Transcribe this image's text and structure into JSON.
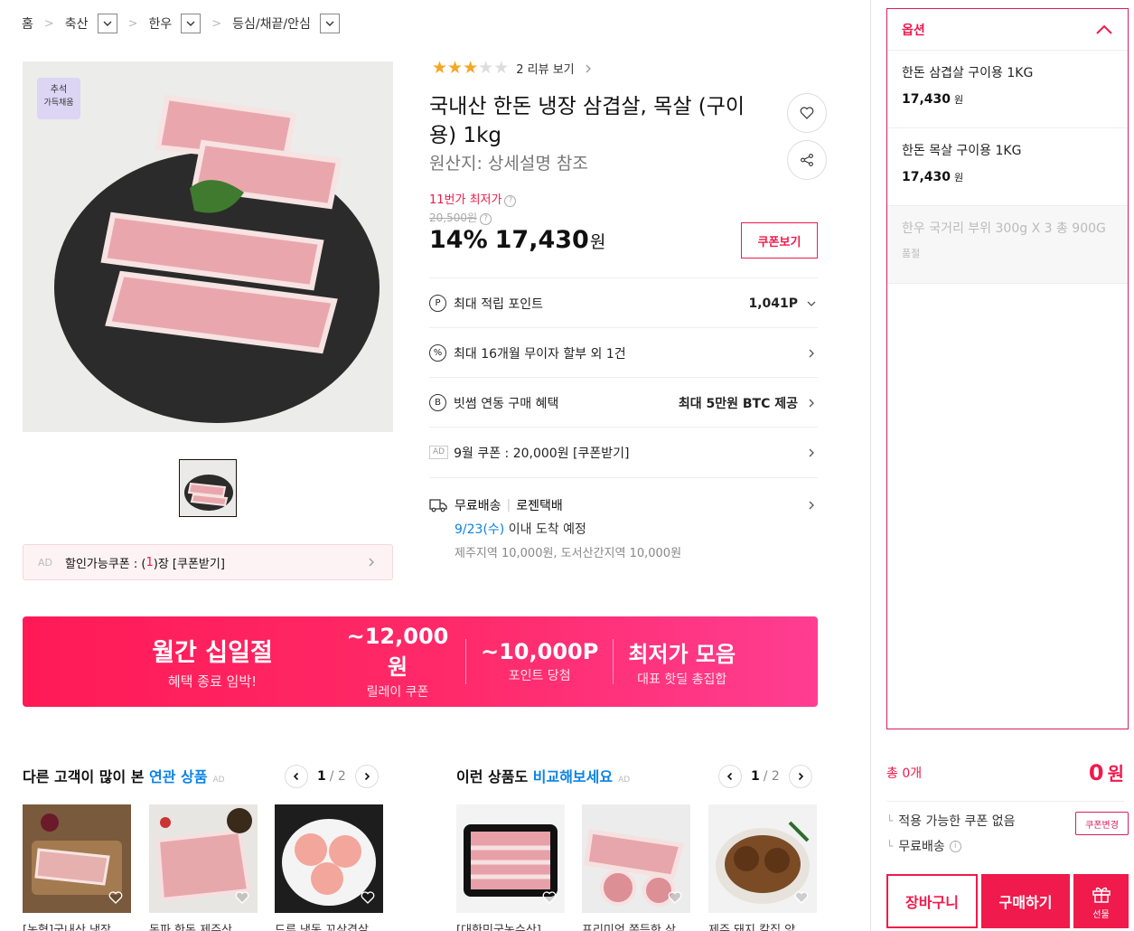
{
  "breadcrumb": {
    "home": "홈",
    "cat1": "축산",
    "cat2": "한우",
    "cat3": "등심/채끝/안심"
  },
  "product": {
    "badge": "추석\n가득채움",
    "rating": 3,
    "review_link": "2 리뷰 보기",
    "title": "국내산 한돈 냉장 삼겹살, 목살 (구이용) 1kg",
    "origin": "원산지:  상세설명 참조",
    "lowest_label": "11번가 최저가",
    "original_price": "20,500원",
    "discount": "14%",
    "price": "17,430",
    "price_unit": "원",
    "coupon_button": "쿠폰보기"
  },
  "benefits": [
    {
      "icon": "P",
      "label": "최대 적립 포인트",
      "value": "1,041P"
    },
    {
      "icon": "%",
      "label": "최대 16개월 무이자 할부 외 1건",
      "value": ""
    },
    {
      "icon": "B",
      "label": "빗썸 연동 구매 혜택",
      "value": "최대 5만원 BTC 제공"
    },
    {
      "icon": "AD",
      "label": "9월 쿠폰 : 20,000원 [쿠폰받기]",
      "value": ""
    }
  ],
  "shipping": {
    "free": "무료배송",
    "carrier": "로젠택배",
    "arrival_date": "9/23(수)",
    "arrival_text": " 이내 도착 예정",
    "extra": "제주지역 10,000원, 도서산간지역 10,000원"
  },
  "coupon_bar": {
    "ad": "AD",
    "text_a": "할인가능쿠폰 : (",
    "count": "1",
    "text_b": ")장 [쿠폰받기]"
  },
  "banner": {
    "title": "월간 십일절",
    "subtitle": "혜택 종료 임박!",
    "seg1_big": "~12,000원",
    "seg1_small": "릴레이 쿠폰",
    "seg2_big": "~10,000P",
    "seg2_small": "포인트 당첨",
    "seg3_big": "최저가 모음",
    "seg3_small": "대표 핫딜 총집합"
  },
  "related": {
    "title_a": "다른 고객이 많이 본 ",
    "title_b": "연관 상품",
    "ad": "AD",
    "page": "1",
    "total": "2",
    "items": [
      "[농협]국내산 냉장",
      "돈파 한돈 제주산",
      "드루 냉동 꼬삼겹살"
    ]
  },
  "compare": {
    "title_a": "이런 상품도 ",
    "title_b": "비교해보세요",
    "ad": "AD",
    "page": "1",
    "total": "2",
    "items": [
      "[대한민국농수산]",
      "프리미엄 쫀득한 삼",
      "제주 돼지 칼집 양"
    ]
  },
  "options": {
    "header": "옵션",
    "items": [
      {
        "name": "한돈 삼겹살 구이용 1KG",
        "price": "17,430",
        "unit": "원"
      },
      {
        "name": "한돈 목살 구이용 1KG",
        "price": "17,430",
        "unit": "원"
      },
      {
        "name": "한우 국거리 부위 300g X 3 총 900G",
        "status": "품절"
      }
    ]
  },
  "summary": {
    "total_label": "총 0개",
    "total_value": "0",
    "total_unit": "원",
    "coupon_line": "적용 가능한 쿠폰 없음",
    "coupon_change": "쿠폰변경",
    "shipping_line": "무료배송",
    "cart": "장바구니",
    "buy": "구매하기",
    "gift": "선물"
  },
  "colors": {
    "accent": "#f01a4c",
    "blue": "#0b83e6",
    "star": "#f5a623"
  }
}
